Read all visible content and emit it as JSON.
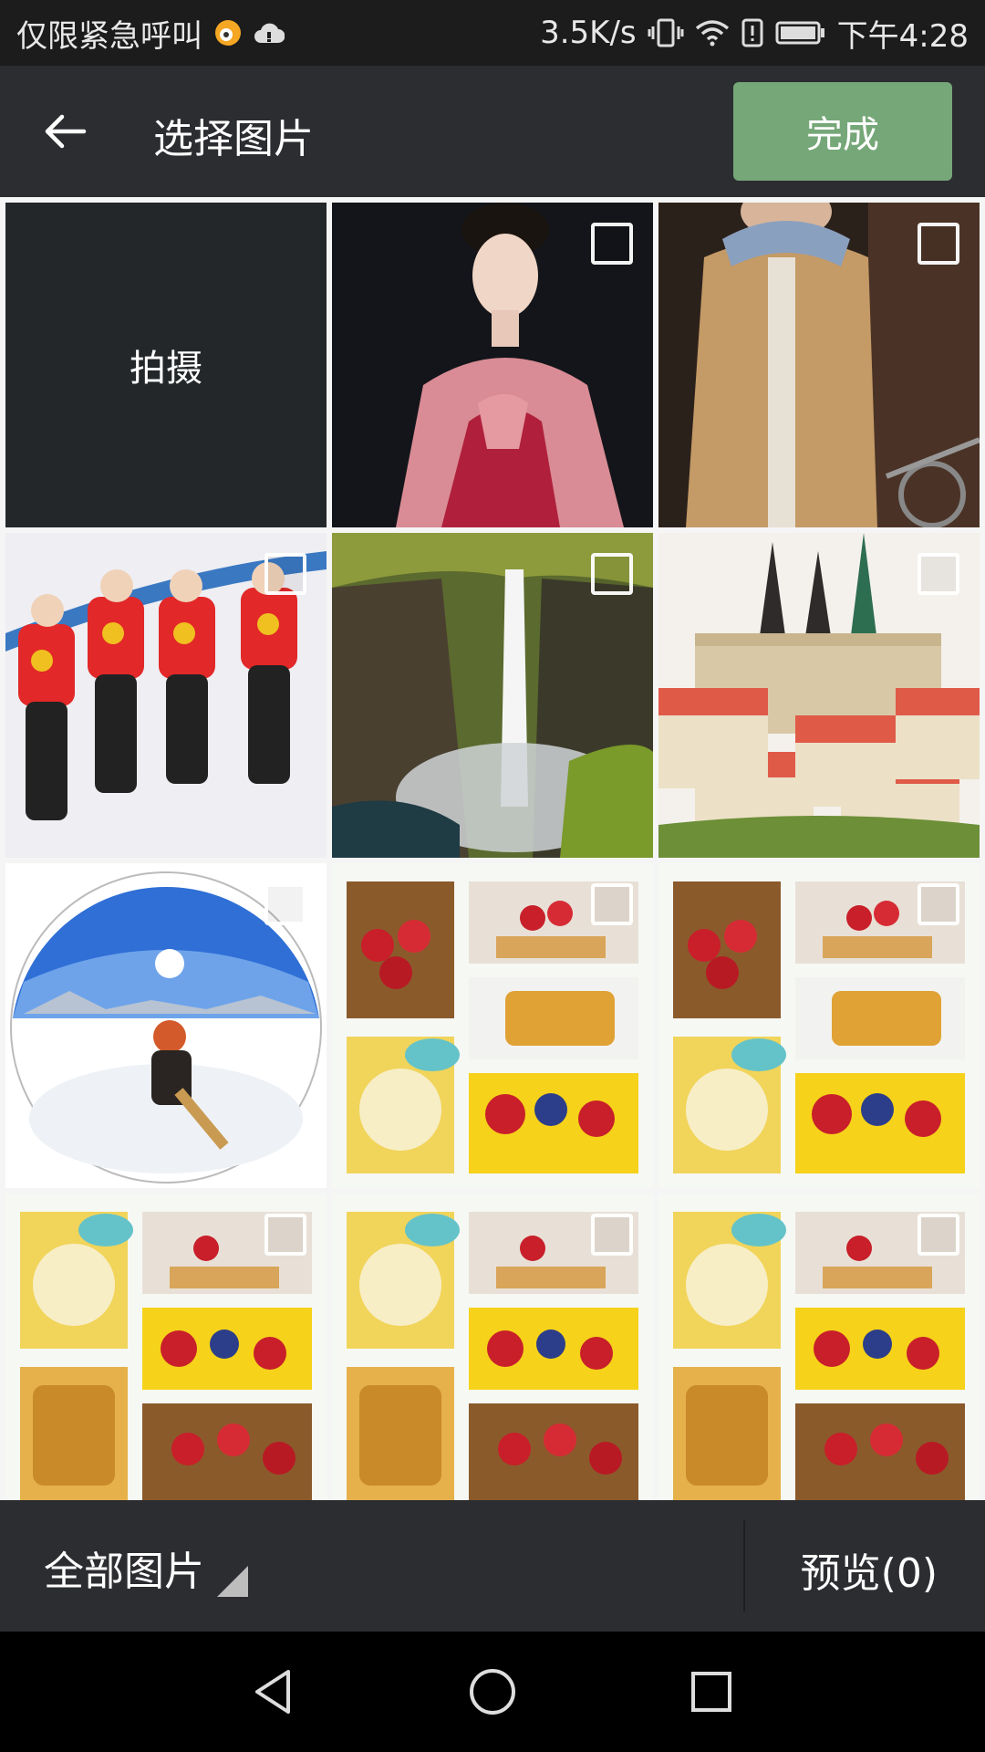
{
  "statusbar": {
    "carrier": "仅限紧急呼叫",
    "speed": "3.5K/s",
    "time": "下午4:28",
    "icons": [
      "weibo-icon",
      "cloud-icon",
      "vibrate-icon",
      "wifi-icon",
      "alert-icon",
      "battery-icon"
    ]
  },
  "topbar": {
    "back_icon": "arrow-left-icon",
    "title": "选择图片",
    "done_label": "完成"
  },
  "grid": {
    "capture_label": "拍摄",
    "photos": [
      {
        "subject": "hanfu-woman"
      },
      {
        "subject": "man-jacket-bicycle"
      },
      {
        "subject": "speed-skaters"
      },
      {
        "subject": "waterfall"
      },
      {
        "subject": "castle-city"
      },
      {
        "subject": "snow-fisheye"
      },
      {
        "subject": "food-collage"
      },
      {
        "subject": "food-collage"
      },
      {
        "subject": "food-collage"
      },
      {
        "subject": "food-collage"
      },
      {
        "subject": "food-collage"
      }
    ]
  },
  "bottombar": {
    "album_label": "全部图片",
    "preview_label": "预览(0)"
  },
  "navbar": {
    "icons": [
      "back-triangle-icon",
      "home-circle-icon",
      "recents-square-icon"
    ]
  },
  "colors": {
    "accent_green": "#76a778",
    "bar_bg": "#2c2d31",
    "status_bg": "#1c1c1c"
  }
}
